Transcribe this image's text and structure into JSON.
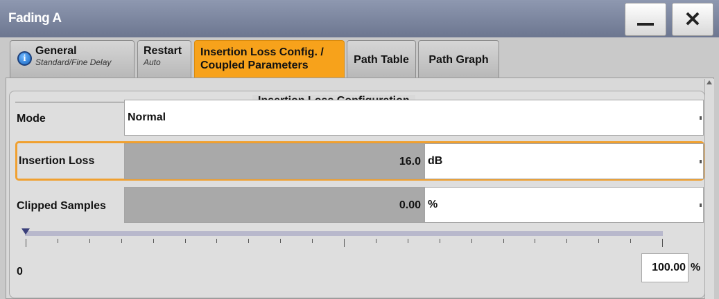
{
  "window": {
    "title": "Fading A"
  },
  "tabs": [
    {
      "label": "General",
      "sub": "Standard/Fine Delay"
    },
    {
      "label": "Restart",
      "sub": "Auto"
    },
    {
      "label_line1": "Insertion Loss Config. /",
      "label_line2": "Coupled Parameters"
    },
    {
      "label": "Path Table"
    },
    {
      "label": "Path Graph"
    }
  ],
  "group": {
    "title": "Insertion Loss Configuration"
  },
  "mode": {
    "label": "Mode",
    "value": "Normal"
  },
  "insertion_loss": {
    "label": "Insertion Loss",
    "value": "16.0",
    "unit": "dB"
  },
  "clipped_samples": {
    "label": "Clipped Samples",
    "value": "0.00",
    "unit": "%"
  },
  "slider": {
    "min_label": "0",
    "max_value": "100.00",
    "max_unit": "%",
    "level": 0.0
  },
  "colors": {
    "active_tab": "#f7a21b",
    "highlight": "#f0a030",
    "titlebar": "#7a84a0"
  },
  "icons": {
    "info": "info-icon",
    "minimize": "minimize-icon",
    "close": "close-icon"
  }
}
